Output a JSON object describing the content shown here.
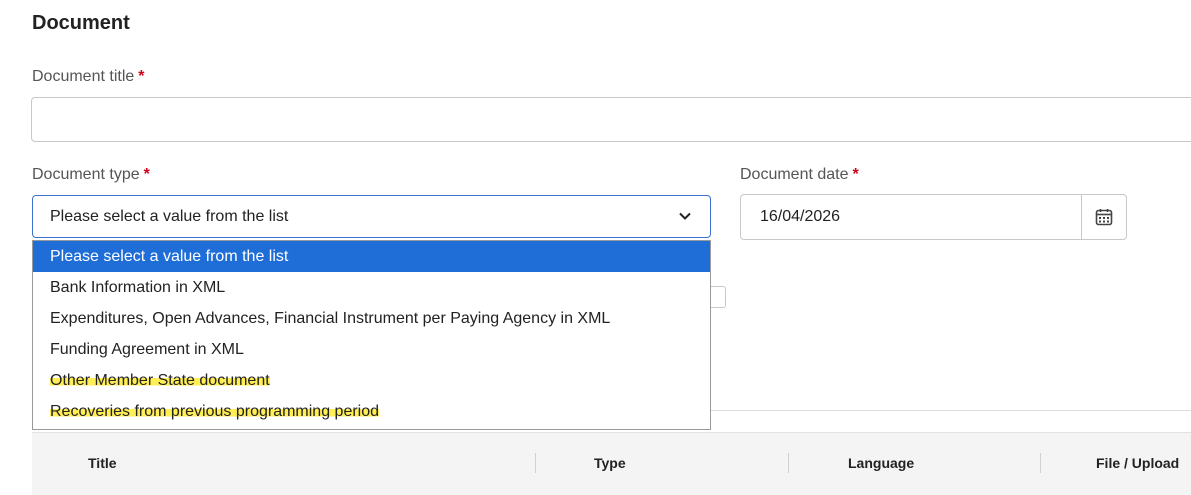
{
  "section": {
    "title": "Document"
  },
  "doc_title": {
    "label": "Document title",
    "required": "*",
    "value": ""
  },
  "doc_type": {
    "label": "Document type",
    "required": "*",
    "selected": "Please select a value from the list",
    "options": [
      "Please select a value from the list",
      "Bank Information in XML",
      "Expenditures, Open Advances, Financial Instrument per Paying Agency in XML",
      "Funding Agreement in XML",
      "Other Member State document",
      "Recoveries from previous programming period"
    ]
  },
  "doc_date": {
    "label": "Document date",
    "required": "*",
    "value": "16/04/2026",
    "button_icon": "calendar-icon"
  },
  "table": {
    "headers": [
      "Title",
      "Type",
      "Language",
      "File / Upload"
    ]
  },
  "colors": {
    "accent": "#1f6ed8",
    "required": "#d0021b",
    "highlight": "#ffee55"
  }
}
